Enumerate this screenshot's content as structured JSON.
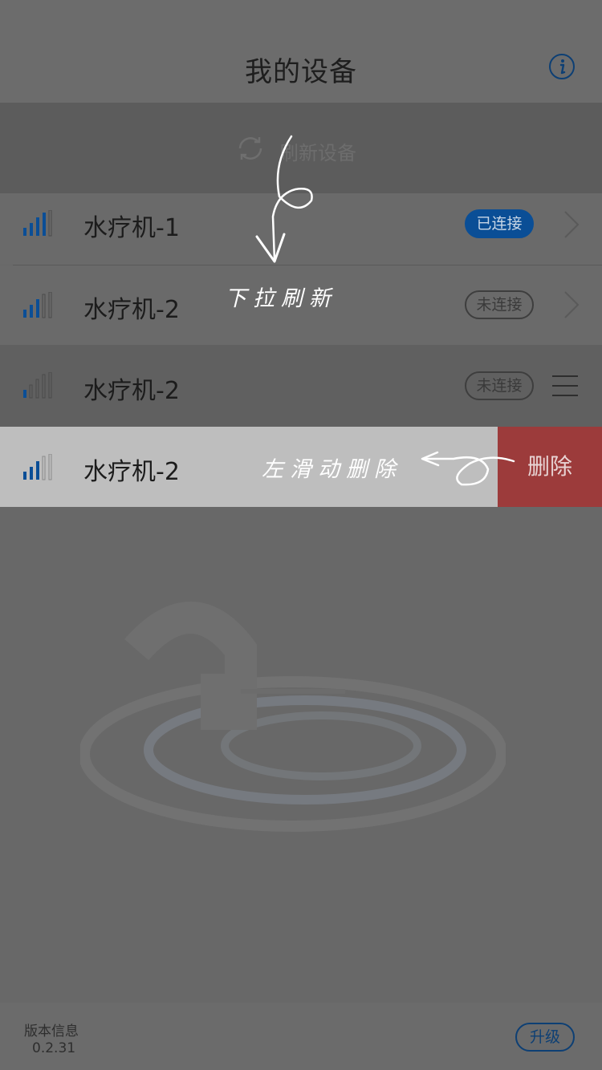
{
  "header": {
    "title": "我的设备",
    "info_icon": "info-icon"
  },
  "refresh": {
    "label": "刷新设备",
    "icon": "refresh-icon"
  },
  "devices": [
    {
      "name": "水疗机-1",
      "status": "已连接",
      "connected": true,
      "signal_bars": 4,
      "action_icon": "chevron-right-icon"
    },
    {
      "name": "水疗机-2",
      "status": "未连接",
      "connected": false,
      "signal_bars": 3,
      "action_icon": "chevron-right-icon"
    },
    {
      "name": "水疗机-2",
      "status": "未连接",
      "connected": false,
      "signal_bars": 1,
      "action_icon": "menu-icon"
    },
    {
      "name": "水疗机-2",
      "swiped": true,
      "signal_bars": 3,
      "delete_label": "删除"
    }
  ],
  "annotations": {
    "pull_to_refresh": "下拉刷新",
    "swipe_to_delete": "左滑动删除"
  },
  "footer": {
    "version_label": "版本信息",
    "version": "0.2.31",
    "upgrade_label": "升级"
  },
  "colors": {
    "accent": "#0a4e96",
    "delete": "#9c3b3b",
    "overlay": "#686868"
  }
}
